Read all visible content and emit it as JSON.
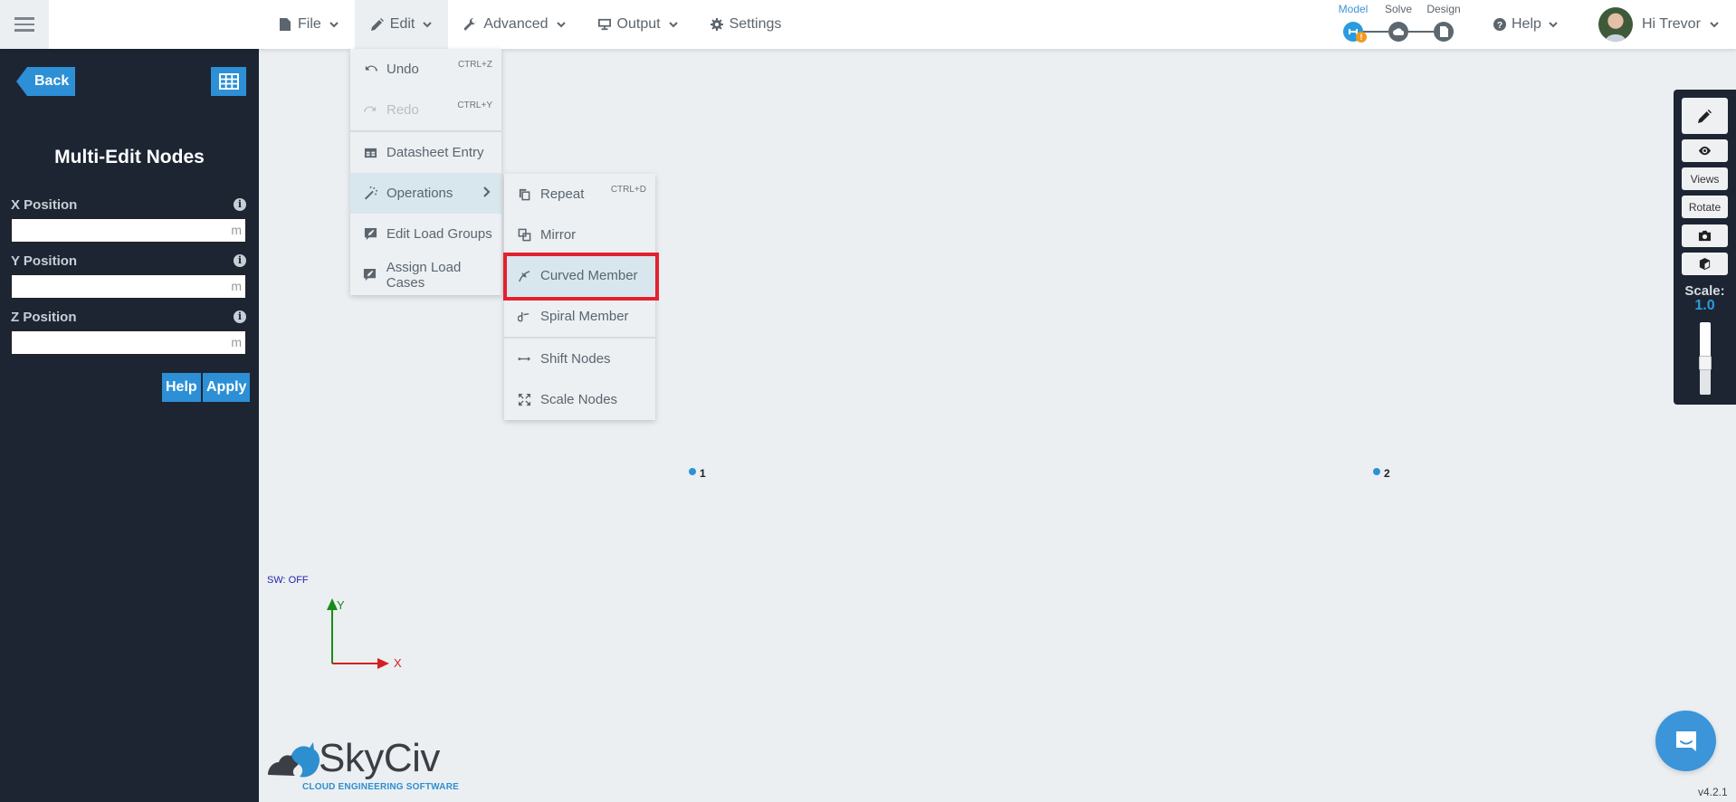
{
  "topbar": {
    "menu_icon": "hamburger-icon",
    "nav": [
      {
        "label": "File",
        "icon": "file-icon"
      },
      {
        "label": "Edit",
        "icon": "pencil-icon",
        "active": true
      },
      {
        "label": "Advanced",
        "icon": "wrench-icon"
      },
      {
        "label": "Output",
        "icon": "monitor-icon"
      },
      {
        "label": "Settings",
        "icon": "gear-icon"
      }
    ],
    "steps": [
      {
        "label": "Model",
        "active": true,
        "badge": "!"
      },
      {
        "label": "Solve"
      },
      {
        "label": "Design"
      }
    ],
    "help_label": "Help",
    "user_label": "Hi Trevor"
  },
  "sidebar": {
    "back_label": "Back",
    "title": "Multi-Edit Nodes",
    "fields": [
      {
        "label": "X Position",
        "value": "",
        "unit": "m"
      },
      {
        "label": "Y Position",
        "value": "",
        "unit": "m"
      },
      {
        "label": "Z Position",
        "value": "",
        "unit": "m"
      }
    ],
    "help_button": "Help",
    "apply_button": "Apply"
  },
  "edit_menu": {
    "items": [
      {
        "label": "Undo",
        "shortcut": "CTRL+Z",
        "icon": "undo-icon"
      },
      {
        "label": "Redo",
        "shortcut": "CTRL+Y",
        "icon": "redo-icon",
        "disabled": true
      },
      {
        "label": "Datasheet Entry",
        "icon": "table-icon"
      },
      {
        "label": "Operations",
        "icon": "magic-wand-icon",
        "has_submenu": true,
        "highlighted": true
      },
      {
        "label": "Edit Load Groups",
        "icon": "comment-edit-icon"
      },
      {
        "label": "Assign Load Cases",
        "icon": "comment-edit-icon"
      }
    ]
  },
  "operations_menu": {
    "items": [
      {
        "label": "Repeat",
        "shortcut": "CTRL+D",
        "icon": "copy-icon"
      },
      {
        "label": "Mirror",
        "icon": "mirror-icon"
      },
      {
        "label": "Curved Member",
        "icon": "curve-icon",
        "highlighted": true
      },
      {
        "label": "Spiral Member",
        "icon": "spiral-icon"
      },
      {
        "label": "Shift Nodes",
        "icon": "arrows-horizontal-icon"
      },
      {
        "label": "Scale Nodes",
        "icon": "expand-icon"
      }
    ]
  },
  "canvas": {
    "nodes": [
      {
        "id": "1"
      },
      {
        "id": "2"
      }
    ],
    "sw_status": "SW: OFF",
    "axis_x_label": "X",
    "axis_y_label": "Y"
  },
  "right_toolbar": {
    "buttons": [
      "pencil-icon",
      "eye-icon",
      "Views",
      "Rotate",
      "camera-icon",
      "cube-icon"
    ],
    "scale_label": "Scale:",
    "scale_value": "1.0"
  },
  "logo": {
    "name": "SkyCiv",
    "tagline": "CLOUD ENGINEERING SOFTWARE"
  },
  "version": "v4.2.1",
  "colors": {
    "accent": "#2d8fd6",
    "sidebar_bg": "#1d2533",
    "canvas_bg": "#ebeff2",
    "highlight_box": "#e3212d",
    "axis_x": "#d42020",
    "axis_y": "#1a8a1a"
  }
}
